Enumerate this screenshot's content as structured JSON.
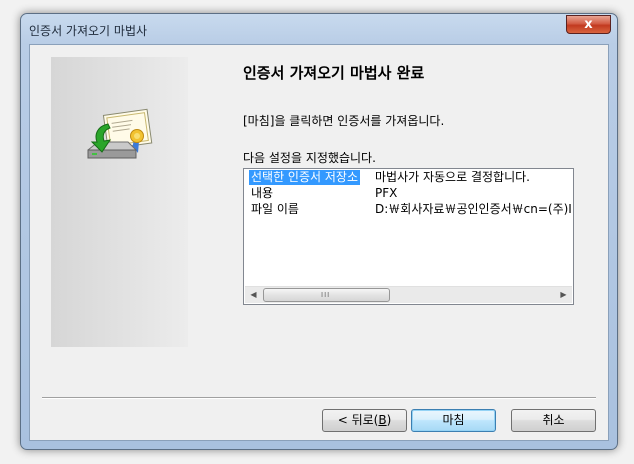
{
  "window": {
    "title": "인증서 가져오기 마법사",
    "close_symbol": "x"
  },
  "main": {
    "heading": "인증서 가져오기 마법사 완료",
    "info_text": "[마침]을 클릭하면 인증서를 가져옵니다.",
    "settings_label": "다음 설정을 지정했습니다.",
    "settings": [
      {
        "key": "선택한 인증서 저장소",
        "value": "마법사가 자동으로 결정합니다.",
        "selected": true
      },
      {
        "key": "내용",
        "value": "PFX",
        "selected": false
      },
      {
        "key": "파일 이름",
        "value": "D:￦회사자료￦공인인증서￦cn=(주)I",
        "selected": false
      }
    ],
    "scroll_grip": "III"
  },
  "buttons": {
    "back_prefix": "< 뒤로(",
    "back_accel": "B",
    "back_suffix": ")",
    "finish": "마침",
    "cancel": "취소"
  },
  "icons": {
    "wizard": "certificate-import-icon",
    "close": "close-icon"
  },
  "colors": {
    "selection": "#3399ff",
    "close_button": "#c9452a"
  }
}
